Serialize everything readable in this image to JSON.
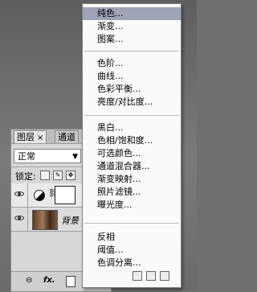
{
  "menu": {
    "groups": [
      [
        "纯色...",
        "渐变...",
        "图案..."
      ],
      [
        "色阶...",
        "曲线...",
        "色彩平衡...",
        "亮度/对比度..."
      ],
      [
        "黑白...",
        "色相/饱和度...",
        "可选颜色...",
        "通道混合器...",
        "渐变映射...",
        "照片滤镜...",
        "曝光度..."
      ],
      [
        "反相",
        "阈值...",
        "色调分离..."
      ]
    ],
    "selected_index": 0
  },
  "panel": {
    "tabs": [
      "图层",
      "通道"
    ],
    "tab_close": "×",
    "blend_mode": "正常",
    "lock_label": "锁定:",
    "layers": [
      {
        "name": "",
        "type": "adjustment"
      },
      {
        "name": "背景",
        "type": "image"
      }
    ],
    "footer_icons": [
      "link-icon",
      "fx-icon",
      "mask-icon",
      "adjustment-icon"
    ],
    "footer_labels": {
      "fx": "fx.",
      "link": "⊖"
    }
  }
}
